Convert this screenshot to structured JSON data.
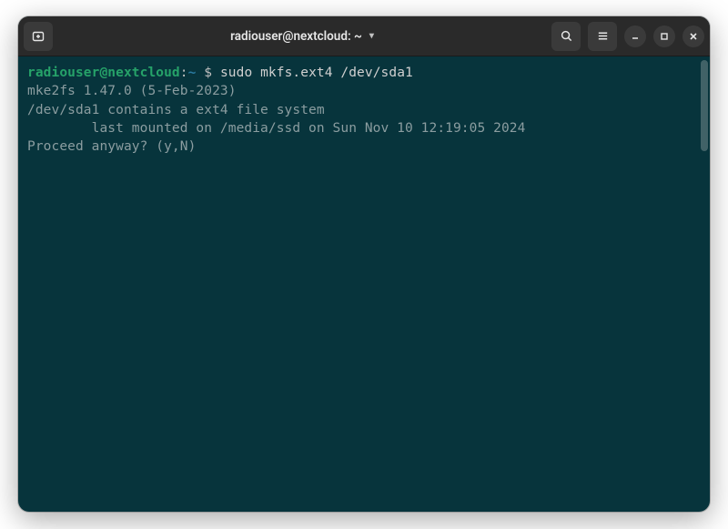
{
  "titlebar": {
    "title": "radiouser@nextcloud: ~"
  },
  "prompt": {
    "user_host": "radiouser@nextcloud",
    "separator": ":",
    "path": "~",
    "symbol": " $ "
  },
  "command": "sudo mkfs.ext4 /dev/sda1",
  "output": {
    "line1": "mke2fs 1.47.0 (5-Feb-2023)",
    "line2": "/dev/sda1 contains a ext4 file system",
    "line3": "        last mounted on /media/ssd on Sun Nov 10 12:19:05 2024",
    "line4": "Proceed anyway? (y,N) "
  }
}
